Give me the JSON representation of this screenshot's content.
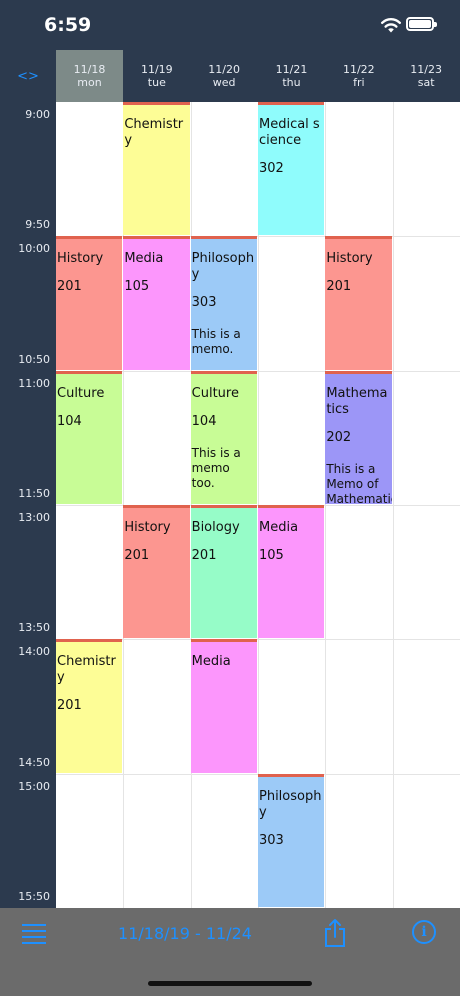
{
  "status": {
    "time": "6:59"
  },
  "header": {
    "toggle_label": "<>",
    "days": [
      {
        "date": "11/18",
        "weekday": "mon",
        "selected": true
      },
      {
        "date": "11/19",
        "weekday": "tue",
        "selected": false
      },
      {
        "date": "11/20",
        "weekday": "wed",
        "selected": false
      },
      {
        "date": "11/21",
        "weekday": "thu",
        "selected": false
      },
      {
        "date": "11/22",
        "weekday": "fri",
        "selected": false
      },
      {
        "date": "11/23",
        "weekday": "sat",
        "selected": false
      }
    ]
  },
  "periods": [
    {
      "start": "9:00",
      "end": "9:50"
    },
    {
      "start": "10:00",
      "end": "10:50"
    },
    {
      "start": "11:00",
      "end": "11:50"
    },
    {
      "start": "13:00",
      "end": "13:50"
    },
    {
      "start": "14:00",
      "end": "14:50"
    },
    {
      "start": "15:00",
      "end": "15:50"
    }
  ],
  "classes": [
    {
      "day": 1,
      "period": 0,
      "name": "Chemistry",
      "room": "",
      "memo": "",
      "color": "#fdfd96"
    },
    {
      "day": 3,
      "period": 0,
      "name": "Medical science",
      "room": "302",
      "memo": "",
      "color": "#8ffcfc"
    },
    {
      "day": 0,
      "period": 1,
      "name": "History",
      "room": "201",
      "memo": "",
      "color": "#fc9690"
    },
    {
      "day": 1,
      "period": 1,
      "name": "Media",
      "room": "105",
      "memo": "",
      "color": "#fc96fc"
    },
    {
      "day": 2,
      "period": 1,
      "name": "Philosophy",
      "room": "303",
      "memo": "This is a memo.",
      "color": "#9ccaf7"
    },
    {
      "day": 4,
      "period": 1,
      "name": "History",
      "room": "201",
      "memo": "",
      "color": "#fc9690"
    },
    {
      "day": 0,
      "period": 2,
      "name": "Culture",
      "room": "104",
      "memo": "",
      "color": "#c8fc96"
    },
    {
      "day": 2,
      "period": 2,
      "name": "Culture",
      "room": "104",
      "memo": "This is a memo too.",
      "color": "#c8fc96"
    },
    {
      "day": 4,
      "period": 2,
      "name": "Mathematics",
      "room": "202",
      "memo": "This is a Memo of Mathematics.",
      "color": "#9c96f7"
    },
    {
      "day": 1,
      "period": 3,
      "name": "History",
      "room": "201",
      "memo": "",
      "color": "#fc9690"
    },
    {
      "day": 2,
      "period": 3,
      "name": "Biology",
      "room": "201",
      "memo": "",
      "color": "#96fcc8"
    },
    {
      "day": 3,
      "period": 3,
      "name": "Media",
      "room": "105",
      "memo": "",
      "color": "#fc96fc"
    },
    {
      "day": 0,
      "period": 4,
      "name": "Chemistry",
      "room": "201",
      "memo": "",
      "color": "#fdfd96"
    },
    {
      "day": 2,
      "period": 4,
      "name": "Media",
      "room": "",
      "memo": "",
      "color": "#fc96fc"
    },
    {
      "day": 3,
      "period": 5,
      "name": "Philosophy",
      "room": "303",
      "memo": "",
      "color": "#9ccaf7"
    }
  ],
  "toolbar": {
    "menu_icon": "menu-icon",
    "range_label": "11/18/19 - 11/24",
    "share_icon": "share-icon",
    "info_icon": "info-icon",
    "info_glyph": "i"
  },
  "colors": {
    "accent": "#1e90ff",
    "background": "#2c3a4e",
    "toolbar": "#6b6b6b",
    "selected_day": "#7d8a88"
  }
}
